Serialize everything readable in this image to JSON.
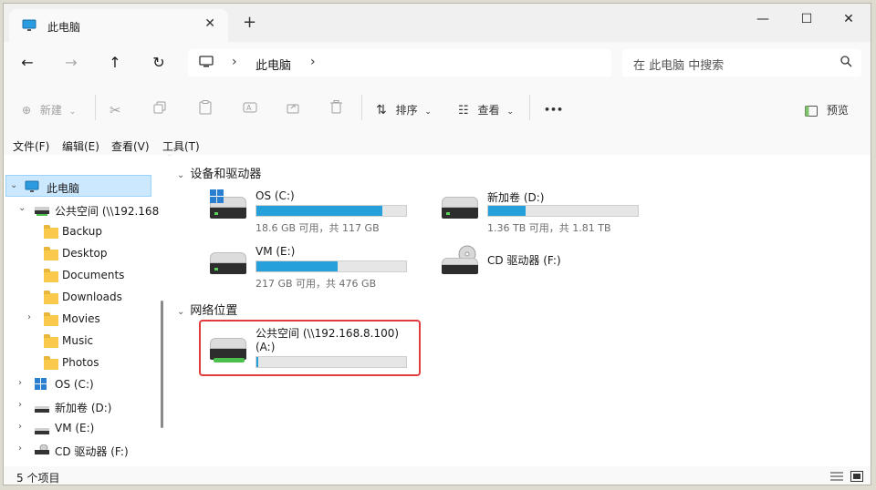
{
  "window": {
    "tab_title": "此电脑",
    "tab_close": "✕",
    "new_tab": "+",
    "minimize": "—",
    "maximize": "☐",
    "close": "✕"
  },
  "nav": {
    "back": "←",
    "forward": "→",
    "up": "↑",
    "refresh": "↻",
    "breadcrumb": "此电脑",
    "breadcrumb_sep": "›",
    "search_placeholder": "在 此电脑 中搜索"
  },
  "commands": {
    "new_label": "新建",
    "sort_label": "排序",
    "view_label": "查看",
    "more": "•••",
    "preview_label": "预览"
  },
  "menu": [
    "文件(F)",
    "编辑(E)",
    "查看(V)",
    "工具(T)"
  ],
  "sidebar": {
    "items": [
      {
        "label": "此电脑"
      },
      {
        "label": "公共空间 (\\\\192.168"
      },
      {
        "label": "Backup"
      },
      {
        "label": "Desktop"
      },
      {
        "label": "Documents"
      },
      {
        "label": "Downloads"
      },
      {
        "label": "Movies"
      },
      {
        "label": "Music"
      },
      {
        "label": "Photos"
      },
      {
        "label": "OS (C:)"
      },
      {
        "label": "新加卷 (D:)"
      },
      {
        "label": "VM (E:)"
      },
      {
        "label": "CD 驱动器 (F:)"
      }
    ]
  },
  "main": {
    "devices_header": "设备和驱动器",
    "network_header": "网络位置",
    "drives": [
      {
        "label": "OS (C:)",
        "size": "18.6 GB 可用，共 117 GB",
        "used_fraction": 0.84
      },
      {
        "label": "新加卷 (D:)",
        "size": "1.36 TB 可用，共 1.81 TB",
        "used_fraction": 0.25
      },
      {
        "label": "VM (E:)",
        "size": "217 GB 可用，共 476 GB",
        "used_fraction": 0.54
      },
      {
        "label": "CD 驱动器 (F:)"
      }
    ],
    "network": {
      "label_line1": "公共空间 (\\\\192.168.8.100)",
      "label_line2": "(A:)",
      "used_fraction": 0.01
    }
  },
  "status": {
    "count": "5 个项目"
  },
  "colors": {
    "accent": "#26a0da",
    "highlight": "#e23b3b",
    "selection": "#cce8ff"
  }
}
